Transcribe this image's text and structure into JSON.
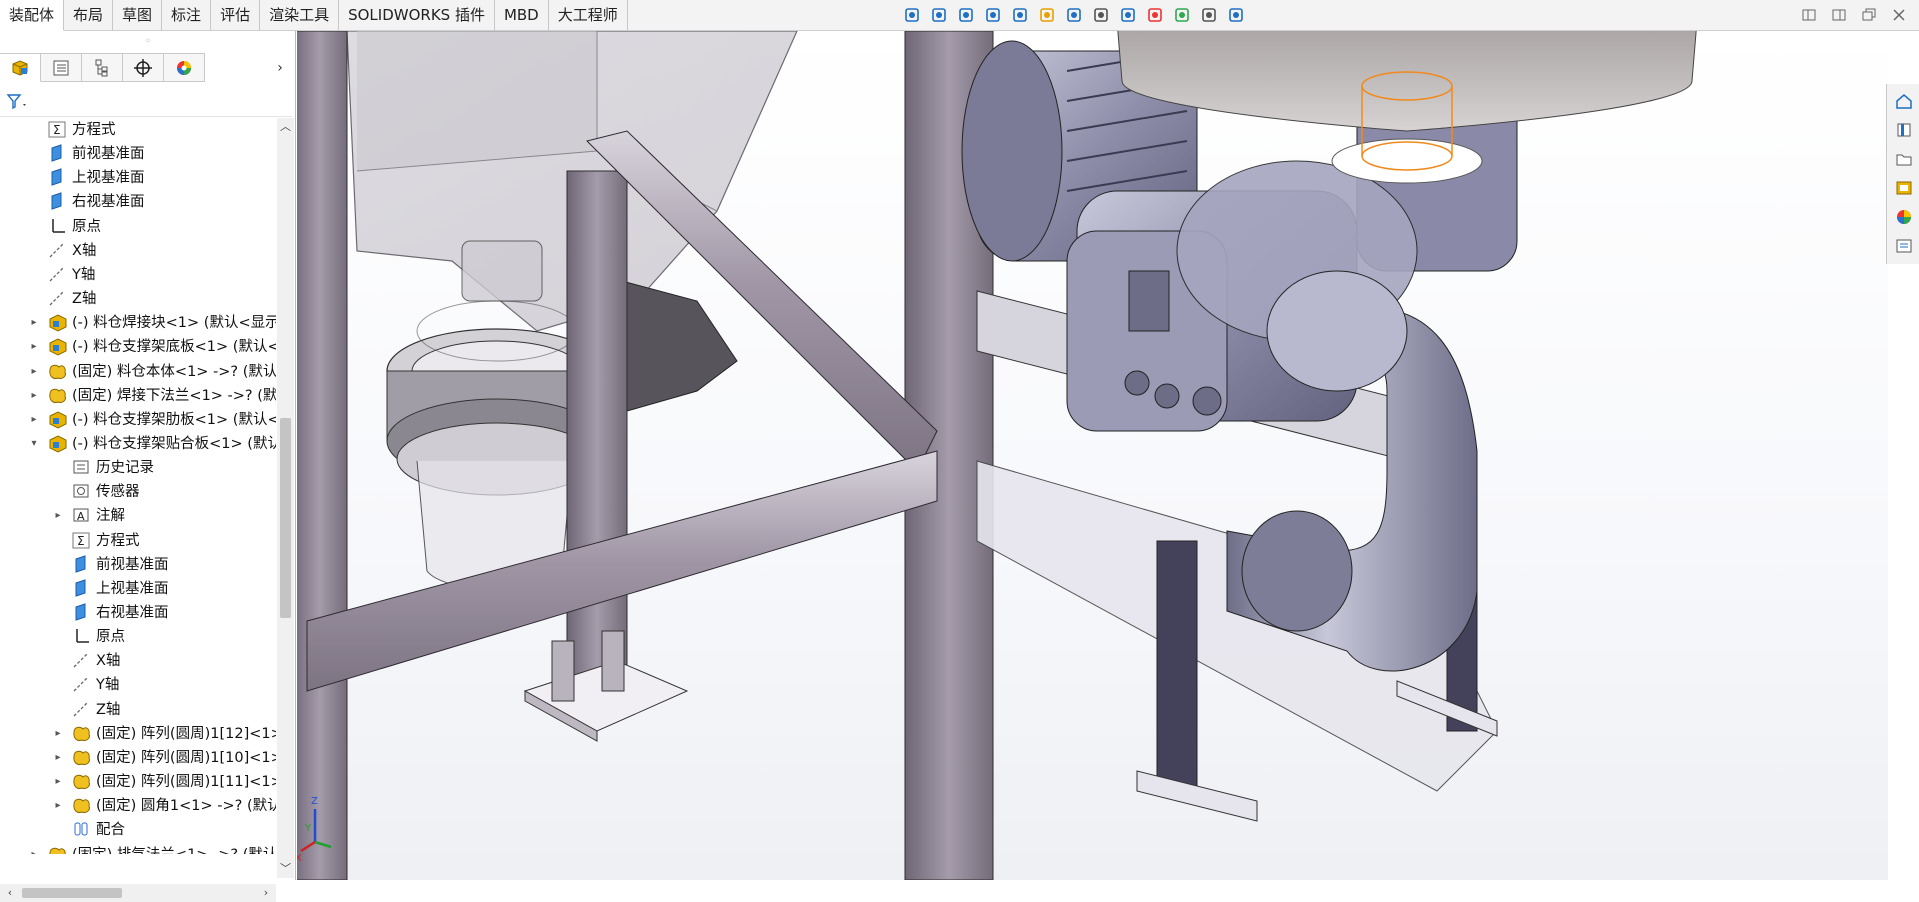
{
  "tabs": [
    {
      "label": "装配体",
      "active": true
    },
    {
      "label": "布局"
    },
    {
      "label": "草图"
    },
    {
      "label": "标注"
    },
    {
      "label": "评估"
    },
    {
      "label": "渲染工具"
    },
    {
      "label": "SOLIDWORKS 插件"
    },
    {
      "label": "MBD"
    },
    {
      "label": "大工程师"
    }
  ],
  "view_toolbar_icons": [
    "view-orientation-icon",
    "zoom-to-fit-icon",
    "zoom-to-area-icon",
    "previous-view-icon",
    "section-view-icon",
    "dynamic-annotation-icon",
    "view-type-icon",
    "display-style-icon",
    "hide-show-icon",
    "edit-appearance-icon",
    "apply-scene-icon",
    "view-settings-icon",
    "display-pane-icon"
  ],
  "window_controls": [
    "tile-left-icon",
    "tile-right-icon",
    "restore-icon",
    "close-icon"
  ],
  "panel": {
    "grip": "◦",
    "tabs": [
      "feature-manager-icon",
      "property-manager-icon",
      "configuration-manager-icon",
      "dimxpert-icon",
      "display-manager-icon"
    ],
    "filter_icon": "filter-icon"
  },
  "tree": [
    {
      "indent": 1,
      "icon": "equation-icon",
      "label": "方程式",
      "expand": ""
    },
    {
      "indent": 1,
      "icon": "plane-icon",
      "label": "前视基准面",
      "expand": ""
    },
    {
      "indent": 1,
      "icon": "plane-icon",
      "label": "上视基准面",
      "expand": ""
    },
    {
      "indent": 1,
      "icon": "plane-icon",
      "label": "右视基准面",
      "expand": ""
    },
    {
      "indent": 1,
      "icon": "origin-icon",
      "label": "原点",
      "expand": ""
    },
    {
      "indent": 1,
      "icon": "axis-icon",
      "label": "X轴",
      "expand": ""
    },
    {
      "indent": 1,
      "icon": "axis-icon",
      "label": "Y轴",
      "expand": ""
    },
    {
      "indent": 1,
      "icon": "axis-icon",
      "label": "Z轴",
      "expand": ""
    },
    {
      "indent": 1,
      "icon": "assembly-icon",
      "label": "(-) 料仓焊接块<1> (默认<显示",
      "expand": "▸"
    },
    {
      "indent": 1,
      "icon": "assembly-icon",
      "label": "(-) 料仓支撑架底板<1> (默认<",
      "expand": "▸"
    },
    {
      "indent": 1,
      "icon": "part-fixed-icon",
      "label": "(固定) 料仓本体<1> ->? (默认",
      "expand": "▸"
    },
    {
      "indent": 1,
      "icon": "part-fixed-icon",
      "label": "(固定) 焊接下法兰<1> ->? (默",
      "expand": "▸"
    },
    {
      "indent": 1,
      "icon": "assembly-icon",
      "label": "(-) 料仓支撑架肋板<1> (默认<",
      "expand": "▸"
    },
    {
      "indent": 1,
      "icon": "assembly-icon",
      "label": "(-) 料仓支撑架贴合板<1> (默认",
      "expand": "▾"
    },
    {
      "indent": 2,
      "icon": "history-icon",
      "label": "历史记录",
      "expand": ""
    },
    {
      "indent": 2,
      "icon": "sensor-icon",
      "label": "传感器",
      "expand": ""
    },
    {
      "indent": 2,
      "icon": "annotation-icon",
      "label": "注解",
      "expand": "▸"
    },
    {
      "indent": 2,
      "icon": "equation-icon",
      "label": "方程式",
      "expand": ""
    },
    {
      "indent": 2,
      "icon": "plane-icon",
      "label": "前视基准面",
      "expand": ""
    },
    {
      "indent": 2,
      "icon": "plane-icon",
      "label": "上视基准面",
      "expand": ""
    },
    {
      "indent": 2,
      "icon": "plane-icon",
      "label": "右视基准面",
      "expand": ""
    },
    {
      "indent": 2,
      "icon": "origin-icon",
      "label": "原点",
      "expand": ""
    },
    {
      "indent": 2,
      "icon": "axis-icon",
      "label": "X轴",
      "expand": ""
    },
    {
      "indent": 2,
      "icon": "axis-icon",
      "label": "Y轴",
      "expand": ""
    },
    {
      "indent": 2,
      "icon": "axis-icon",
      "label": "Z轴",
      "expand": ""
    },
    {
      "indent": 2,
      "icon": "part-fixed-icon",
      "label": "(固定) 阵列(圆周)1[12]<1>",
      "expand": "▸"
    },
    {
      "indent": 2,
      "icon": "part-fixed-icon",
      "label": "(固定) 阵列(圆周)1[10]<1>",
      "expand": "▸"
    },
    {
      "indent": 2,
      "icon": "part-fixed-icon",
      "label": "(固定) 阵列(圆周)1[11]<1>",
      "expand": "▸"
    },
    {
      "indent": 2,
      "icon": "part-fixed-icon",
      "label": "(固定) 圆角1<1> ->? (默认",
      "expand": "▸"
    },
    {
      "indent": 2,
      "icon": "mates-icon",
      "label": "配合",
      "expand": ""
    },
    {
      "indent": 1,
      "icon": "part-fixed-icon",
      "label": "(固定) 排气法兰<1> ->? (默认",
      "expand": "▸"
    }
  ],
  "triad": {
    "x": "X",
    "y": "Y",
    "z": "Z"
  },
  "taskpane_icons": [
    "solidworks-resources-icon",
    "design-library-icon",
    "file-explorer-icon",
    "view-palette-icon",
    "appearances-icon",
    "custom-properties-icon"
  ],
  "colors": {
    "accent_blue": "#1f6fc4",
    "part_yellow": "#e8b400",
    "selection_orange": "#f08a1c",
    "frame_steel": "#8e8593",
    "blower_blue": "#8a8aa8"
  }
}
